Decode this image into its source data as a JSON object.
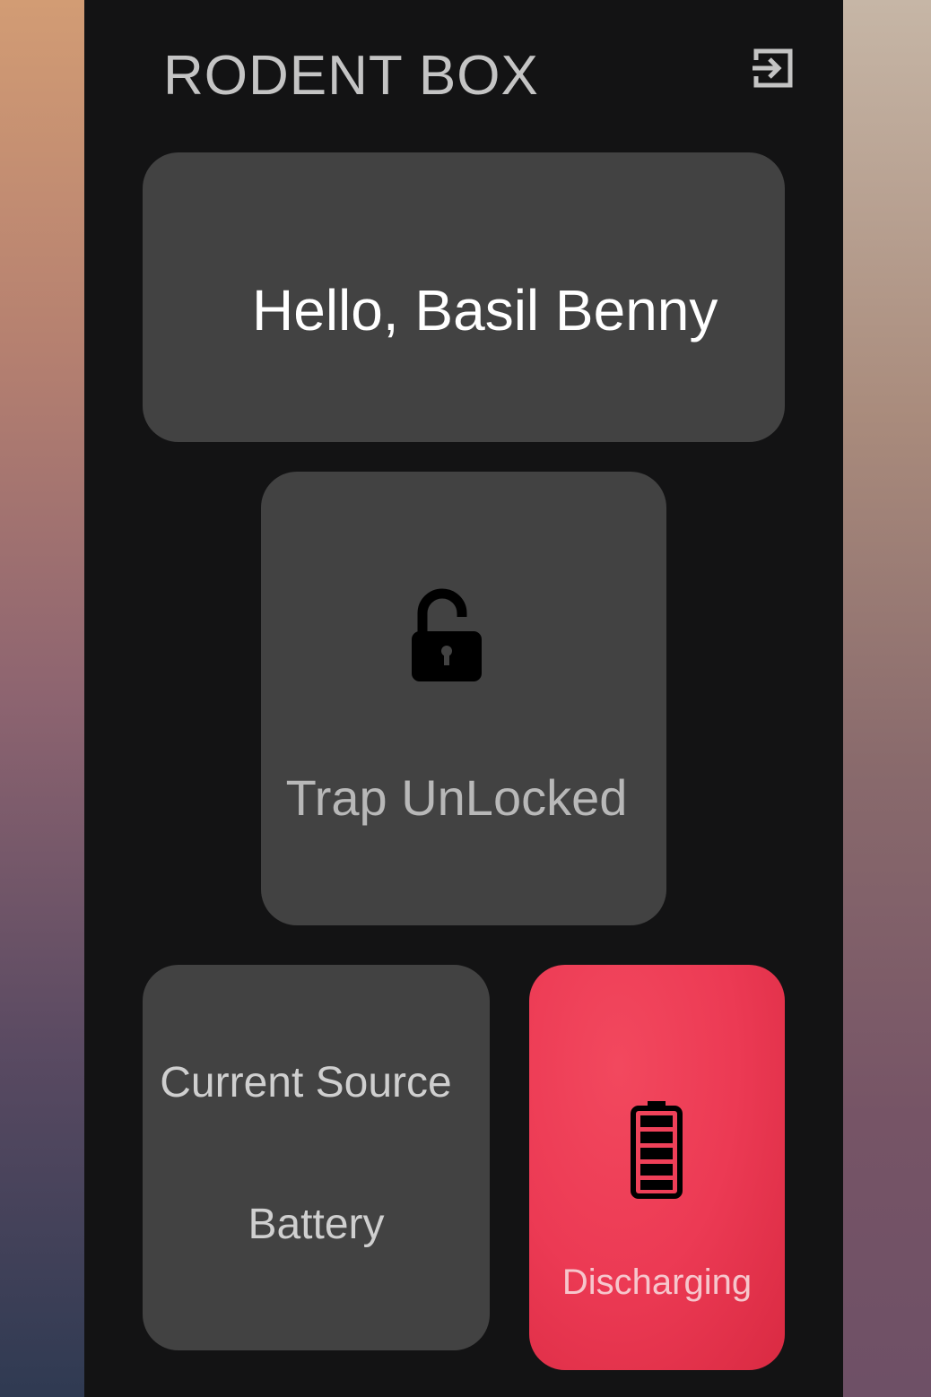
{
  "header": {
    "title": "RODENT BOX",
    "exit_icon": "exit-to-app-icon"
  },
  "greeting": {
    "text": "Hello, Basil Benny"
  },
  "trap": {
    "icon": "lock-open-icon",
    "status": "Trap UnLocked"
  },
  "power": {
    "label": "Current Source",
    "value": "Battery"
  },
  "battery": {
    "icon": "battery-full-icon",
    "status": "Discharging",
    "card_color": "#ec3a54"
  },
  "colors": {
    "background": "#131314",
    "card": "#424242",
    "title_text": "#c4c4c4"
  }
}
